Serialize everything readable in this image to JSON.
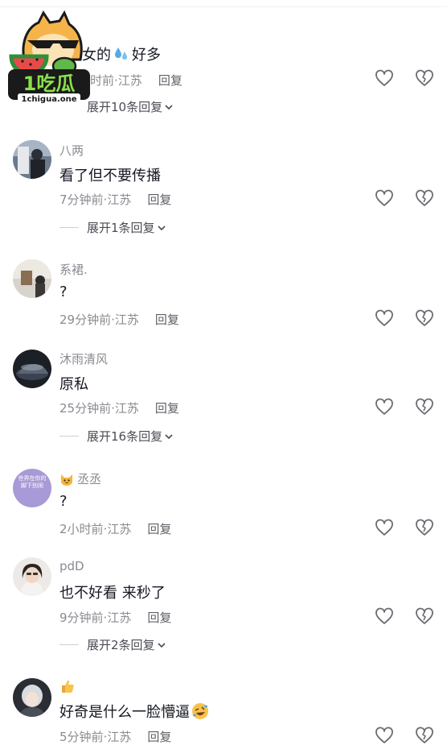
{
  "watermark": {
    "brand_text": "1吃瓜",
    "domain_text": "1chigua.one"
  },
  "colors": {
    "text": "#161823",
    "muted": "#8a8b91",
    "reply": "#5f6067",
    "icon": "#6b6c72"
  },
  "comments": [
    {
      "username": "",
      "text_before": "女的",
      "emoji": "sweat-droplets",
      "text_after": "好多",
      "time": "时前",
      "location": "江苏",
      "reply_label": "回复",
      "expand_label": "展开10条回复"
    },
    {
      "username": "八两",
      "text": "看了但不要传播",
      "time": "7分钟前",
      "location": "江苏",
      "reply_label": "回复",
      "expand_label": "展开1条回复"
    },
    {
      "username": "系裙.",
      "text": "?",
      "time": "29分钟前",
      "location": "江苏",
      "reply_label": "回复"
    },
    {
      "username": "沐雨清风",
      "text": "原私",
      "time": "25分钟前",
      "location": "江苏",
      "reply_label": "回复",
      "expand_label": "展开16条回复"
    },
    {
      "username": "丞丞",
      "username_badge": "cat-emoji",
      "avatar_text": "世界在你的脚下别闹",
      "text": "?",
      "time": "2小时前",
      "location": "江苏",
      "reply_label": "回复"
    },
    {
      "username": "pdD",
      "text": "也不好看 来秒了",
      "time": "9分钟前",
      "location": "江苏",
      "reply_label": "回复",
      "expand_label": "展开2条回复"
    },
    {
      "username": "",
      "username_badge": "thumbs-up-emoji",
      "text": "好奇是什么一脸懵逼",
      "emoji": "rofl",
      "time": "5分钟前",
      "location": "江苏",
      "reply_label": "回复"
    }
  ],
  "separator": " · "
}
